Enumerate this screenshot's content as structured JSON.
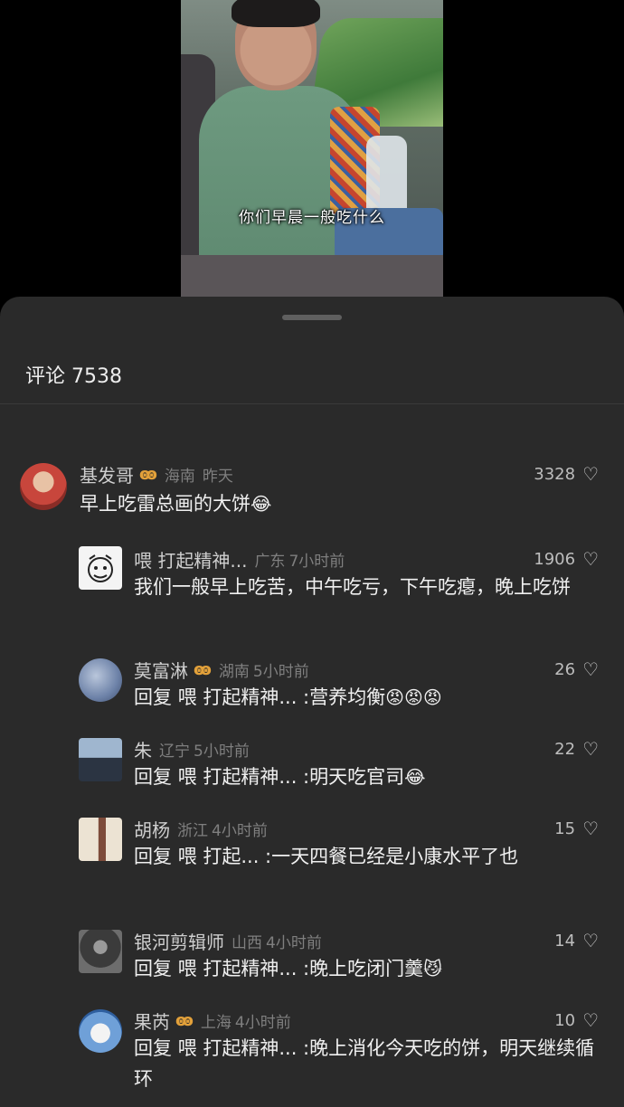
{
  "video": {
    "subtitle": "你们早晨一般吃什么"
  },
  "comments_header": {
    "title": "评论 7538"
  },
  "comments": [
    {
      "name": "基发哥",
      "badge": "ꙭ",
      "location": "海南",
      "time": "昨天",
      "likes": "3328",
      "text": "早上吃雷总画的大饼",
      "emoji": "😂",
      "avatar_icon": "person-avatar"
    },
    {
      "name": "喂 打起精神...",
      "location": "广东",
      "time": "7小时前",
      "likes": "1906",
      "text": "我们一般早上吃苦，中午吃亏，下午吃瘪，晚上吃饼",
      "avatar_icon": "cartoon-face-avatar"
    },
    {
      "name": "莫富淋",
      "badge": "ꙭ",
      "location": "湖南",
      "time": "5小时前",
      "likes": "26",
      "text": "回复 喂 打起精神... :营养均衡",
      "emoji": "😡😡😡",
      "avatar_icon": "skydiver-avatar"
    },
    {
      "name": "朱",
      "location": "辽宁",
      "time": "5小时前",
      "likes": "22",
      "text": "回复 喂 打起精神... :明天吃官司",
      "emoji": "😂",
      "avatar_icon": "building-avatar"
    },
    {
      "name": "胡杨",
      "location": "浙江",
      "time": "4小时前",
      "likes": "15",
      "text": "回复 喂 打起... :一天四餐已经是小康水平了也",
      "avatar_icon": "painting-avatar"
    },
    {
      "name": "银河剪辑师",
      "location": "山西",
      "time": "4小时前",
      "likes": "14",
      "text": "回复 喂 打起精神... :晚上吃闭门羹",
      "emoji": "😼",
      "avatar_icon": "warrior-avatar"
    },
    {
      "name": "果芮",
      "badge": "ꙭ",
      "location": "上海",
      "time": "4小时前",
      "likes": "10",
      "text": "回复 喂 打起精神... :晚上消化今天吃的饼，明天继续循环",
      "avatar_icon": "anime-avatar"
    }
  ],
  "icons": {
    "heart": "♡"
  },
  "colors": {
    "sheet": "#2a2a2a",
    "badge": "#e3a13a",
    "meta": "#7f7f7f"
  }
}
